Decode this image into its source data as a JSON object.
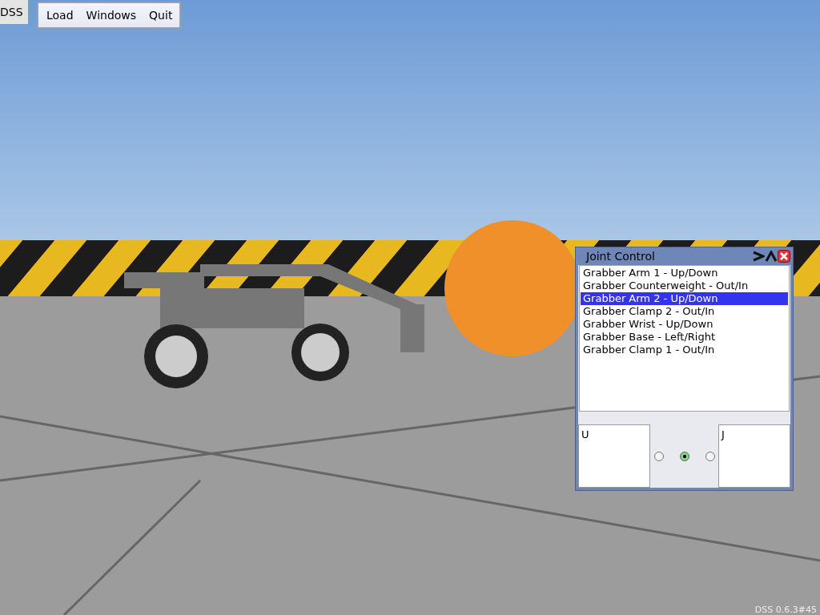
{
  "menu": {
    "title": "DSS",
    "items": [
      "Load",
      "Windows",
      "Quit"
    ]
  },
  "joint_control": {
    "title": "Joint Control",
    "joints": [
      {
        "label": "Grabber Arm 1 - Up/Down",
        "selected": false
      },
      {
        "label": "Grabber Counterweight - Out/In",
        "selected": false
      },
      {
        "label": "Grabber Arm 2 - Up/Down",
        "selected": true
      },
      {
        "label": "Grabber Clamp 2 - Out/In",
        "selected": false
      },
      {
        "label": "Grabber Wrist - Up/Down",
        "selected": false
      },
      {
        "label": "Grabber Base - Left/Right",
        "selected": false
      },
      {
        "label": "Grabber Clamp 1 - Out/In",
        "selected": false
      }
    ],
    "left_key": "U",
    "right_key": "J",
    "modes": [
      {
        "selected": false
      },
      {
        "selected": true
      },
      {
        "selected": false
      }
    ]
  },
  "version": "DSS 0.6.3#45"
}
